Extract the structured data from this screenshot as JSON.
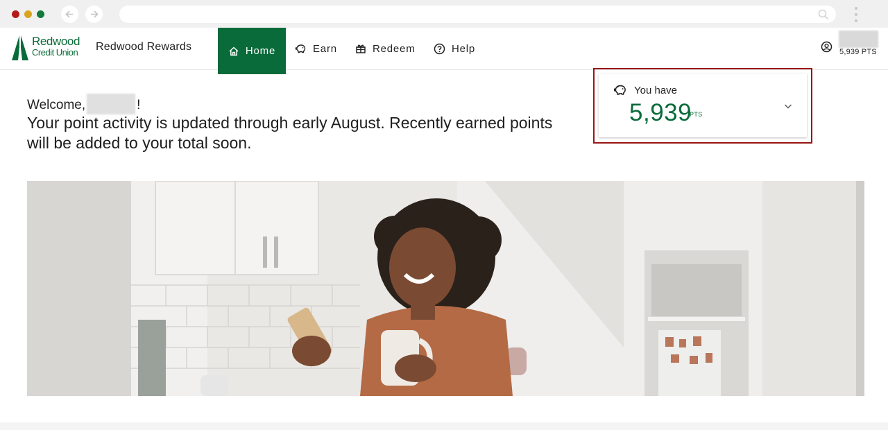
{
  "brand": {
    "logo_line1": "Redwood",
    "logo_line2": "Credit Union",
    "app_name": "Redwood Rewards",
    "accent_color": "#0a6b3a",
    "highlight_color": "#9a1414"
  },
  "nav": {
    "items": [
      {
        "label": "Home",
        "icon": "home-icon",
        "active": true
      },
      {
        "label": "Earn",
        "icon": "piggy-bank-icon"
      },
      {
        "label": "Redeem",
        "icon": "gift-icon"
      },
      {
        "label": "Help",
        "icon": "help-circle-icon"
      }
    ]
  },
  "user": {
    "points": "5,939 PTS",
    "icon": "user-circle-icon"
  },
  "welcome": {
    "greeting": "Welcome,",
    "suffix": "!",
    "activity": "Your point activity is updated through early August. Recently earned points will be added to your total soon."
  },
  "points_card": {
    "label": "You have",
    "value": "5,939",
    "unit": "PTS",
    "icon": "piggy-bank-icon",
    "toggle_icon": "chevron-down-icon"
  },
  "hero": {
    "description_icon": "hero-photo"
  }
}
